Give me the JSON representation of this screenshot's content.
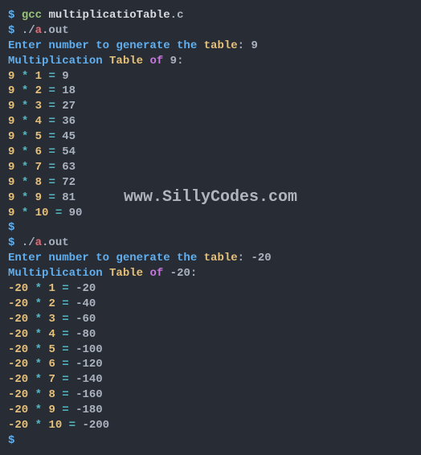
{
  "watermark": "www.SillyCodes.com",
  "prompt": "$",
  "compile": {
    "cmd": "gcc",
    "file": "multiplicatioTable",
    "ext": ".c"
  },
  "run": {
    "dot_slash": "./",
    "a": "a",
    "dot_out": ".out"
  },
  "enter_prompt": {
    "p1": "Enter number to generate the",
    "p2": "table",
    "colon": ":"
  },
  "header": {
    "p1": "Multiplication",
    "p2": "Table",
    "p3": "of",
    "colon": ":"
  },
  "star": "*",
  "eq": "=",
  "run1": {
    "input": "9",
    "n": "9",
    "rows": [
      {
        "a": "9",
        "b": "1",
        "r": "9"
      },
      {
        "a": "9",
        "b": "2",
        "r": "18"
      },
      {
        "a": "9",
        "b": "3",
        "r": "27"
      },
      {
        "a": "9",
        "b": "4",
        "r": "36"
      },
      {
        "a": "9",
        "b": "5",
        "r": "45"
      },
      {
        "a": "9",
        "b": "6",
        "r": "54"
      },
      {
        "a": "9",
        "b": "7",
        "r": "63"
      },
      {
        "a": "9",
        "b": "8",
        "r": "72"
      },
      {
        "a": "9",
        "b": "9",
        "r": "81"
      },
      {
        "a": "9",
        "b": "10",
        "r": "90"
      }
    ]
  },
  "run2": {
    "input": "-20",
    "n": "-20",
    "rows": [
      {
        "a": "-20",
        "b": "1",
        "r": "-20"
      },
      {
        "a": "-20",
        "b": "2",
        "r": "-40"
      },
      {
        "a": "-20",
        "b": "3",
        "r": "-60"
      },
      {
        "a": "-20",
        "b": "4",
        "r": "-80"
      },
      {
        "a": "-20",
        "b": "5",
        "r": "-100"
      },
      {
        "a": "-20",
        "b": "6",
        "r": "-120"
      },
      {
        "a": "-20",
        "b": "7",
        "r": "-140"
      },
      {
        "a": "-20",
        "b": "8",
        "r": "-160"
      },
      {
        "a": "-20",
        "b": "9",
        "r": "-180"
      },
      {
        "a": "-20",
        "b": "10",
        "r": "-200"
      }
    ]
  }
}
